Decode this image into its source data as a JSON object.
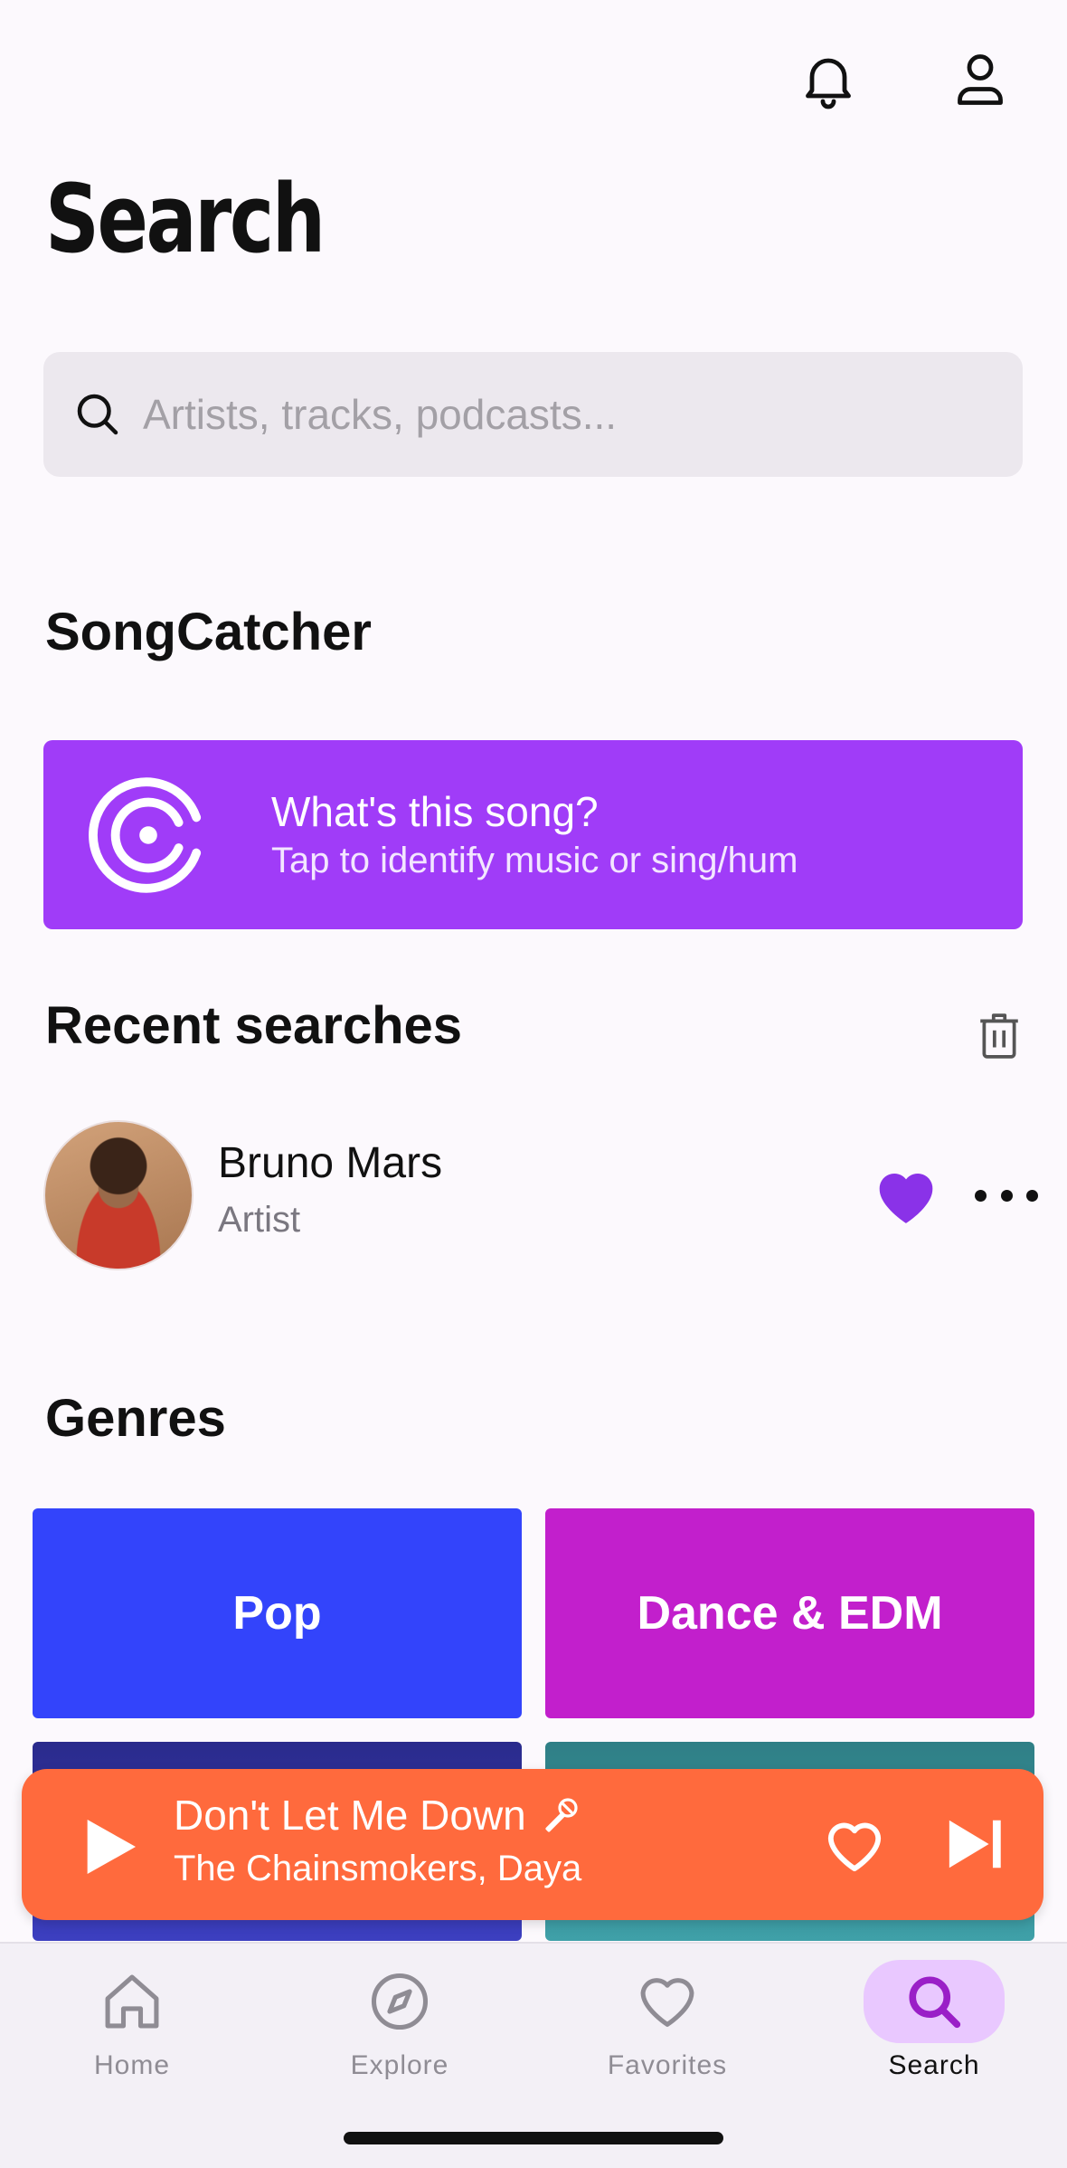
{
  "header": {
    "title": "Search",
    "icons": [
      "bell-icon",
      "user-icon"
    ]
  },
  "search": {
    "placeholder": "Artists, tracks, podcasts...",
    "icon": "search-icon"
  },
  "songcatcher": {
    "section_title": "SongCatcher",
    "title": "What's this song?",
    "subtitle": "Tap to identify music or sing/hum",
    "color": "#a03cf8"
  },
  "recent": {
    "section_title": "Recent searches",
    "items": [
      {
        "name": "Bruno Mars",
        "type": "Artist",
        "liked": true
      }
    ]
  },
  "genres": {
    "section_title": "Genres",
    "items": [
      {
        "label": "Pop",
        "color": "#3344fb"
      },
      {
        "label": "Dance & EDM",
        "color": "#c21fcc"
      },
      {
        "label": "",
        "color": "#2a2b8c"
      },
      {
        "label": "",
        "color": "#2f7f86"
      }
    ]
  },
  "now_playing": {
    "title": "Don't Let Me Down",
    "artist": "The Chainsmokers, Daya",
    "color": "#ff6a3d"
  },
  "tabs": [
    {
      "label": "Home",
      "icon": "home-icon"
    },
    {
      "label": "Explore",
      "icon": "compass-icon"
    },
    {
      "label": "Favorites",
      "icon": "heart-icon"
    },
    {
      "label": "Search",
      "icon": "search-icon",
      "active": true
    }
  ]
}
